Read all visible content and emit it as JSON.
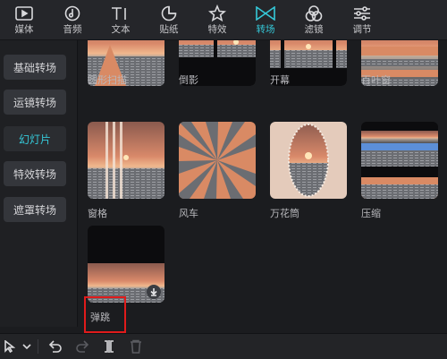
{
  "toolbar": {
    "tabs": [
      {
        "label": "媒体",
        "icon": "media-icon"
      },
      {
        "label": "音频",
        "icon": "audio-icon"
      },
      {
        "label": "文本",
        "icon": "text-icon"
      },
      {
        "label": "贴纸",
        "icon": "sticker-icon"
      },
      {
        "label": "特效",
        "icon": "effects-icon"
      },
      {
        "label": "转场",
        "icon": "transition-icon",
        "active": true
      },
      {
        "label": "滤镜",
        "icon": "filter-icon"
      },
      {
        "label": "调节",
        "icon": "adjust-icon"
      }
    ],
    "accent": "#35c8d8"
  },
  "sidebar": {
    "items": [
      {
        "label": "基础转场"
      },
      {
        "label": "运镜转场"
      },
      {
        "label": "幻灯片",
        "active": true
      },
      {
        "label": "特效转场"
      },
      {
        "label": "遮罩转场"
      }
    ]
  },
  "grid": {
    "items": [
      {
        "label": "圆形扫描"
      },
      {
        "label": "倒影"
      },
      {
        "label": "开幕"
      },
      {
        "label": "百叶窗"
      },
      {
        "label": "窗格"
      },
      {
        "label": "风车"
      },
      {
        "label": "万花筒"
      },
      {
        "label": "压缩"
      },
      {
        "label": "弹跳",
        "download": true,
        "highlighted": true
      }
    ]
  },
  "bottom": {
    "tools": [
      "cursor-icon",
      "chevron-down-icon",
      "undo-icon",
      "redo-icon",
      "split-icon",
      "delete-icon"
    ]
  }
}
